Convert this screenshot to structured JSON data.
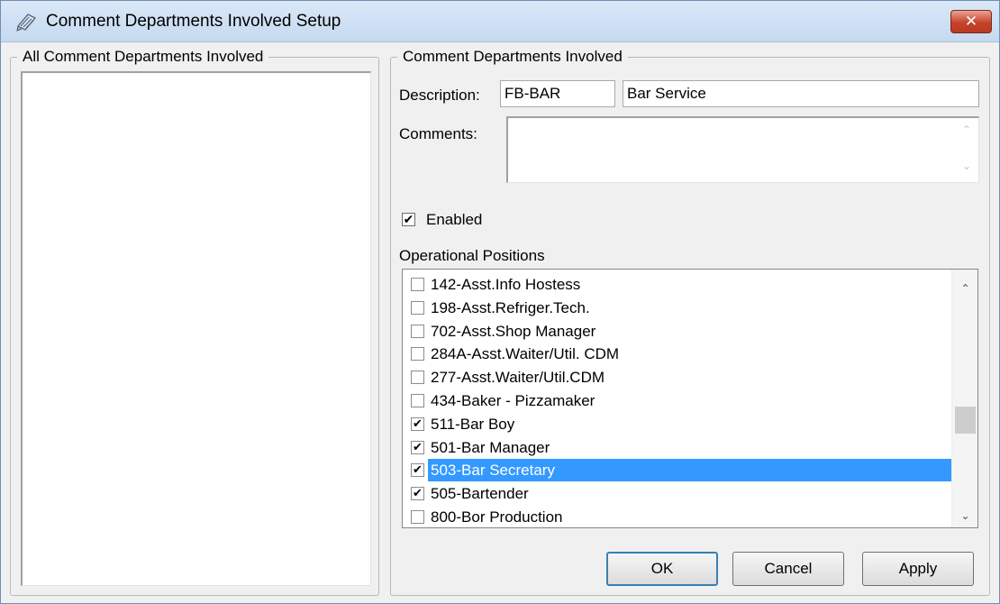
{
  "window": {
    "title": "Comment Departments Involved Setup",
    "close_glyph": "✕",
    "icon": "comment-setup-icon"
  },
  "left_group": {
    "legend": "All Comment Departments Involved",
    "items": []
  },
  "right_group": {
    "legend": "Comment Departments Involved",
    "description_label": "Description:",
    "code_value": "FB-BAR",
    "name_value": "Bar Service",
    "comments_label": "Comments:",
    "comments_value": "",
    "enabled_label": "Enabled",
    "enabled_checked": true,
    "positions_label": "Operational Positions"
  },
  "positions": [
    {
      "label": "142-Asst.Info Hostess",
      "checked": false,
      "selected": false
    },
    {
      "label": "198-Asst.Refriger.Tech.",
      "checked": false,
      "selected": false
    },
    {
      "label": "702-Asst.Shop Manager",
      "checked": false,
      "selected": false
    },
    {
      "label": "284A-Asst.Waiter/Util. CDM",
      "checked": false,
      "selected": false
    },
    {
      "label": "277-Asst.Waiter/Util.CDM",
      "checked": false,
      "selected": false
    },
    {
      "label": "434-Baker - Pizzamaker",
      "checked": false,
      "selected": false
    },
    {
      "label": "511-Bar Boy",
      "checked": true,
      "selected": false
    },
    {
      "label": "501-Bar Manager",
      "checked": true,
      "selected": false
    },
    {
      "label": "503-Bar Secretary",
      "checked": true,
      "selected": true
    },
    {
      "label": "505-Bartender",
      "checked": true,
      "selected": false
    },
    {
      "label": "800-Bor Production",
      "checked": false,
      "selected": false
    }
  ],
  "buttons": {
    "ok": "OK",
    "cancel": "Cancel",
    "apply": "Apply"
  },
  "glyphs": {
    "check": "✔",
    "scroll_up": "⌃",
    "scroll_down": "⌄"
  },
  "colors": {
    "selection": "#3399ff",
    "close_button": "#c7432a"
  }
}
